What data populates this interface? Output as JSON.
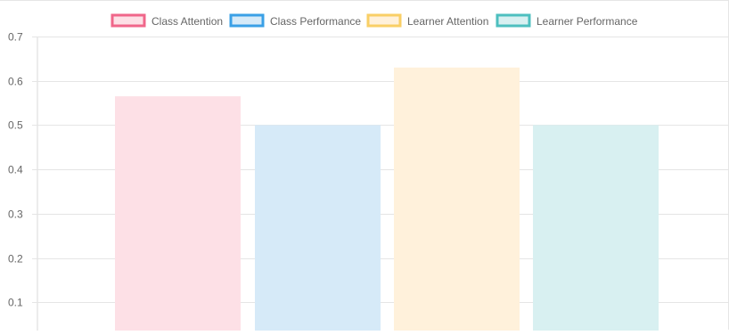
{
  "chart_data": {
    "type": "bar",
    "series": [
      {
        "name": "Class Attention",
        "value": 0.565,
        "fill": "#fde0e6",
        "border": "#f0668a"
      },
      {
        "name": "Class Performance",
        "value": 0.5,
        "fill": "#d6eaf8",
        "border": "#3aa0e6"
      },
      {
        "name": "Learner Attention",
        "value": 0.63,
        "fill": "#fff1db",
        "border": "#f9cf66"
      },
      {
        "name": "Learner Performance",
        "value": 0.5,
        "fill": "#d8f0f1",
        "border": "#4dbfbf"
      }
    ],
    "y_ticks": [
      "0.1",
      "0.2",
      "0.3",
      "0.4",
      "0.5",
      "0.6",
      "0.7"
    ],
    "ylim": [
      0,
      0.7
    ],
    "grid": true,
    "legend_position": "top-center"
  }
}
